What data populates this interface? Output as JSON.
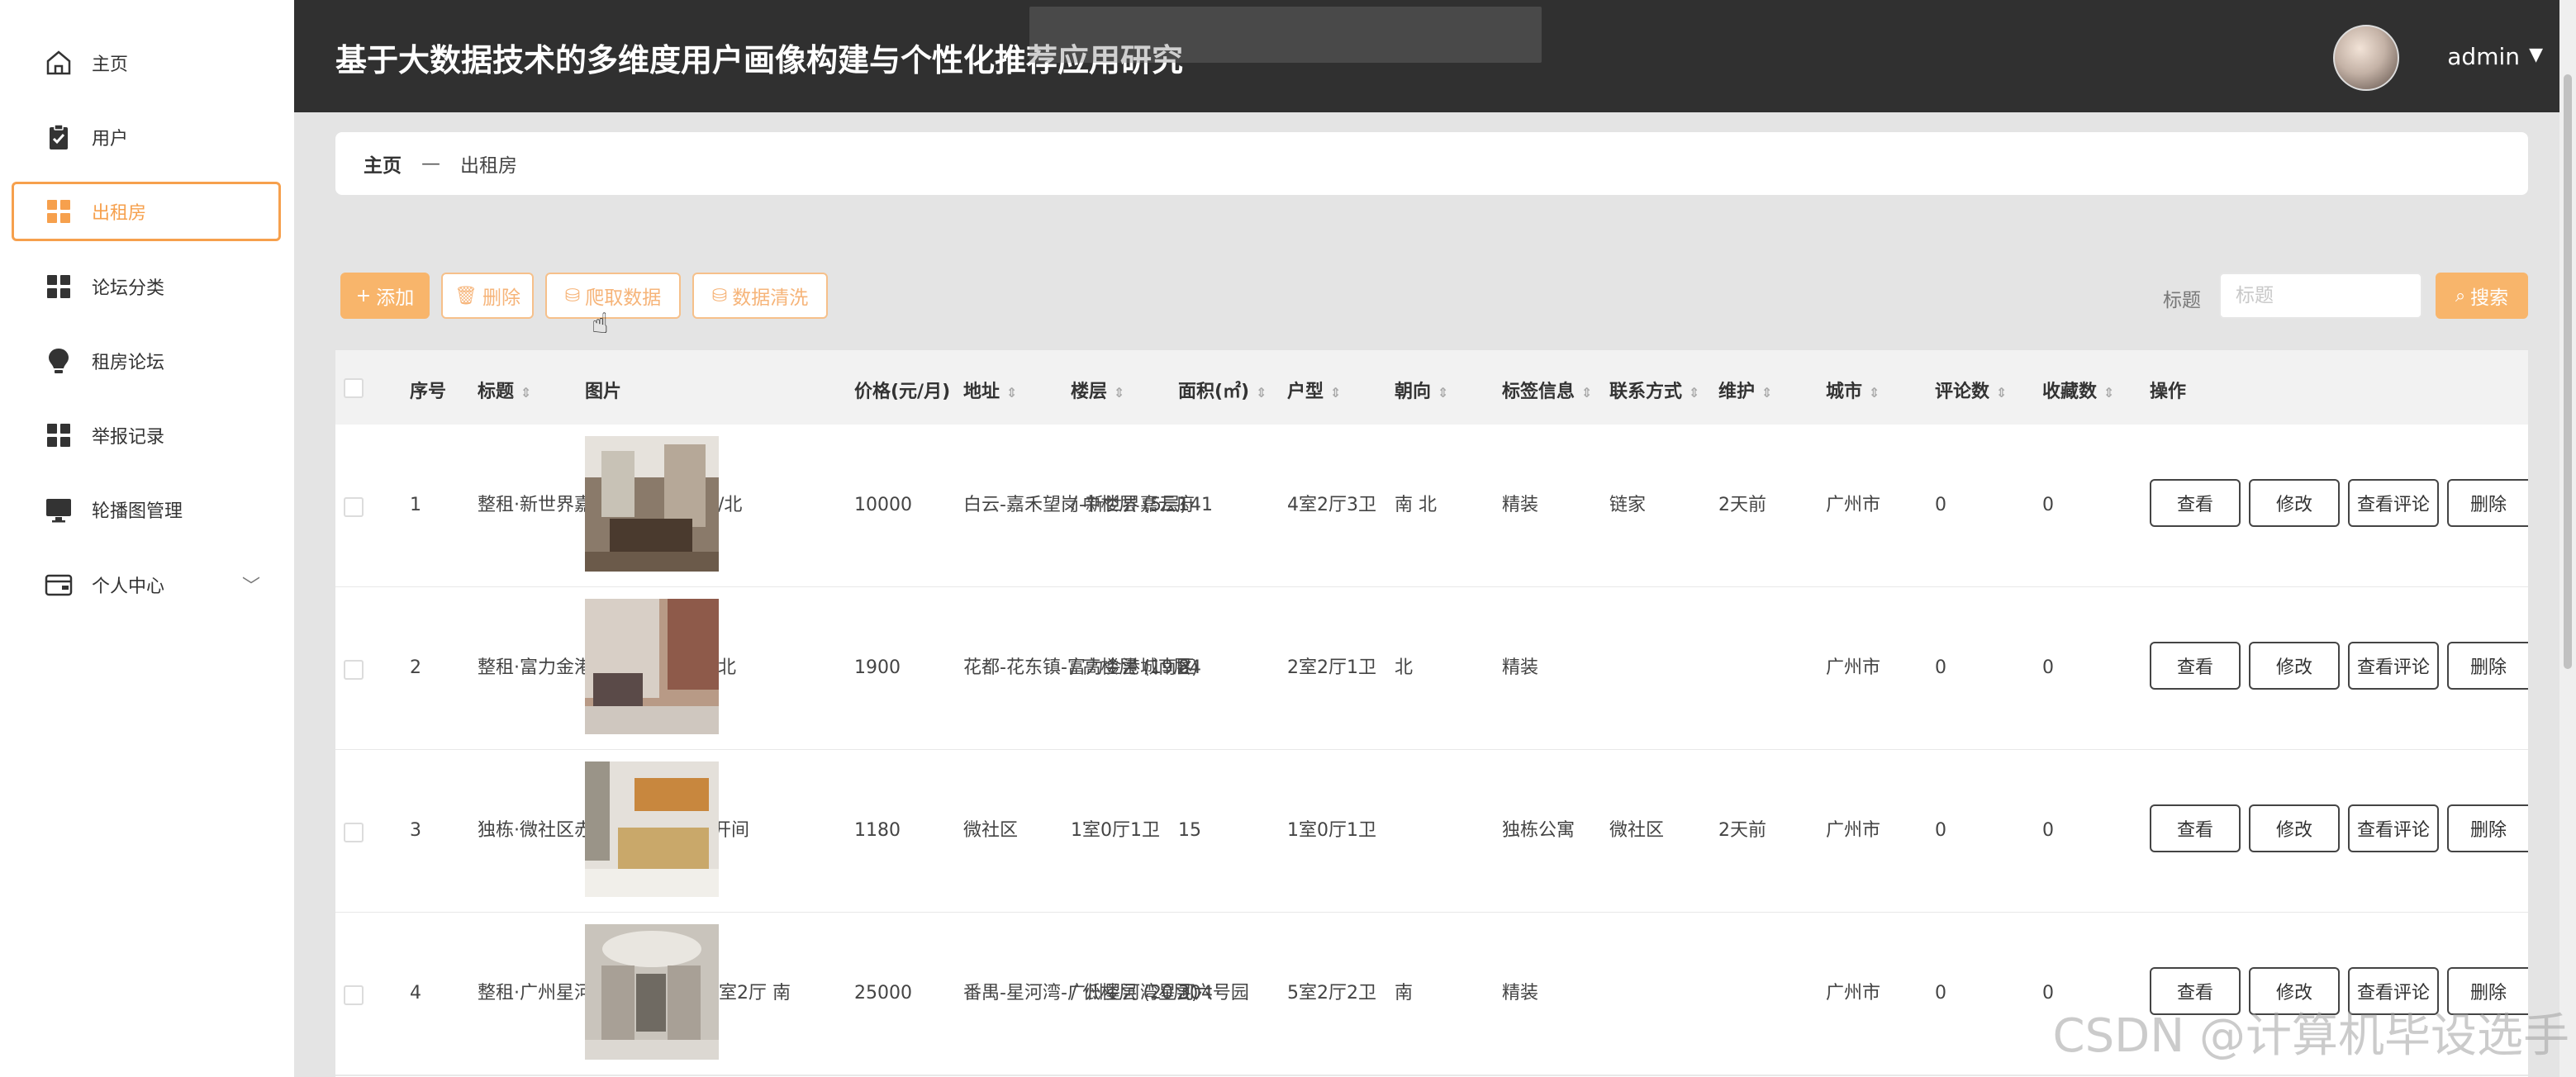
{
  "app": {
    "title": "基于大数据技术的多维度用户画像构建与个性化推荐应用研究",
    "user": "admin"
  },
  "sidebar": {
    "items": [
      {
        "label": "主页",
        "icon": "home-icon"
      },
      {
        "label": "用户",
        "icon": "clipboard-icon"
      },
      {
        "label": "出租房",
        "icon": "grid-icon",
        "active": true
      },
      {
        "label": "论坛分类",
        "icon": "grid-icon"
      },
      {
        "label": "租房论坛",
        "icon": "bulb-icon"
      },
      {
        "label": "举报记录",
        "icon": "grid-icon"
      },
      {
        "label": "轮播图管理",
        "icon": "monitor-icon"
      },
      {
        "label": "个人中心",
        "icon": "wallet-icon"
      }
    ]
  },
  "breadcrumb": {
    "home": "主页",
    "separator": "—",
    "current": "出租房"
  },
  "toolbar": {
    "add": "添加",
    "delete": "删除",
    "crawl": "爬取数据",
    "clean": "数据清洗",
    "search_label": "标题",
    "search_placeholder": "标题",
    "search_button": "搜索"
  },
  "table": {
    "headers": {
      "index": "序号",
      "title": "标题",
      "image": "图片",
      "price": "价格(元/月)",
      "address": "地址",
      "floor": "楼层",
      "area": "面积(㎡)",
      "layout": "户型",
      "orientation": "朝向",
      "tags": "标签信息",
      "contact": "联系方式",
      "maintenance": "维护",
      "city": "城市",
      "comments": "评论数",
      "favorites": "收藏数",
      "actions": "操作"
    },
    "rows": [
      {
        "index": "1",
        "title": "整租·新世界嘉云府 4室2厅 南/北",
        "price": "10000",
        "address": "白云-嘉禾望岗-新世界嘉云府",
        "floor": "/ 中楼层 (5层)",
        "area": "141",
        "layout": "4室2厅3卫",
        "orientation": "南 北",
        "tags": "精装",
        "contact": "链家",
        "maintenance": "2天前",
        "city": "广州市",
        "comments": "0",
        "favorites": "0"
      },
      {
        "index": "2",
        "title": "整租·富力金港城南区 2室2厅 北",
        "price": "1900",
        "address": "花都-花东镇-富力金港城南区",
        "floor": "/ 高楼层 (19层)",
        "area": "84",
        "layout": "2室2厅1卫",
        "orientation": "北",
        "tags": "精装",
        "contact": "",
        "maintenance": "",
        "city": "广州市",
        "comments": "0",
        "favorites": "0"
      },
      {
        "index": "3",
        "title": "独栋·微社区赤岗店 精美单间 开间",
        "price": "1180",
        "address": "微社区",
        "floor": "1室0厅1卫",
        "area": "15",
        "layout": "1室0厅1卫",
        "orientation": "",
        "tags": "独栋公寓",
        "contact": "微社区",
        "maintenance": "2天前",
        "city": "广州市",
        "comments": "0",
        "favorites": "0"
      },
      {
        "index": "4",
        "title": "整租·广州星河湾星河六号园 5室2厅 南",
        "price": "25000",
        "address": "番禺-星河湾-广州星河湾星河六号园",
        "floor": "/ 低楼层 (20层)",
        "area": "304",
        "layout": "5室2厅2卫",
        "orientation": "南",
        "tags": "精装",
        "contact": "",
        "maintenance": "",
        "city": "广州市",
        "comments": "0",
        "favorites": "0"
      }
    ],
    "row_actions": {
      "view": "查看",
      "edit": "修改",
      "view_comments": "查看评论",
      "delete": "删除"
    }
  },
  "watermark": "CSDN @计算机毕设选手"
}
